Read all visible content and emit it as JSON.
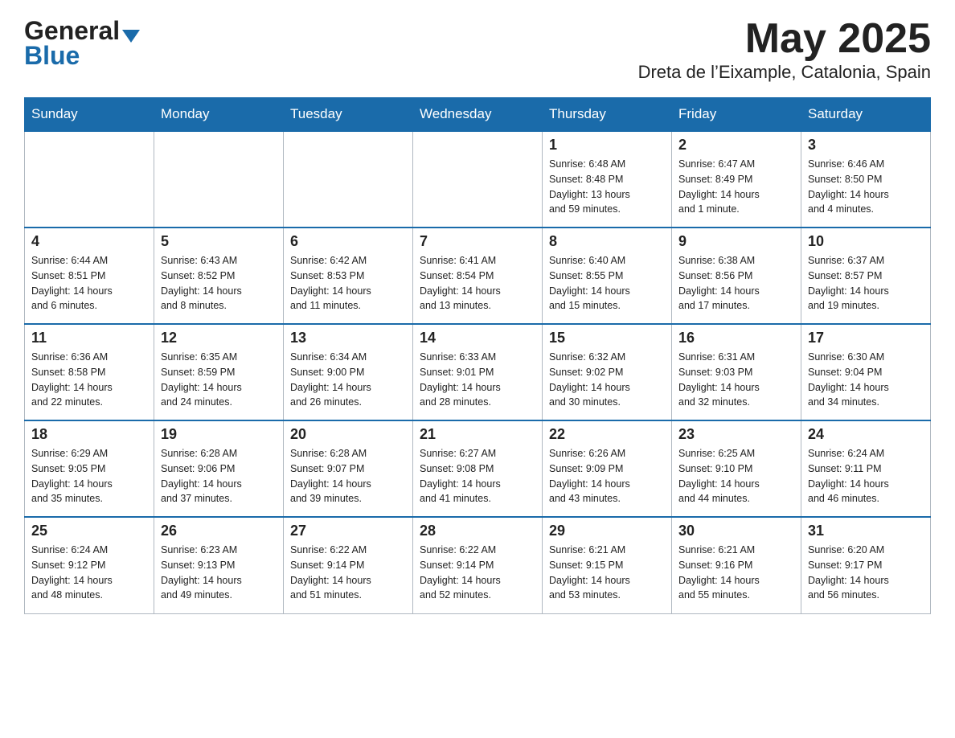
{
  "header": {
    "logo_general": "General",
    "logo_blue": "Blue",
    "title": "May 2025",
    "subtitle": "Dreta de l’Eixample, Catalonia, Spain"
  },
  "days_of_week": [
    "Sunday",
    "Monday",
    "Tuesday",
    "Wednesday",
    "Thursday",
    "Friday",
    "Saturday"
  ],
  "weeks": [
    [
      {
        "day": "",
        "info": ""
      },
      {
        "day": "",
        "info": ""
      },
      {
        "day": "",
        "info": ""
      },
      {
        "day": "",
        "info": ""
      },
      {
        "day": "1",
        "info": "Sunrise: 6:48 AM\nSunset: 8:48 PM\nDaylight: 13 hours\nand 59 minutes."
      },
      {
        "day": "2",
        "info": "Sunrise: 6:47 AM\nSunset: 8:49 PM\nDaylight: 14 hours\nand 1 minute."
      },
      {
        "day": "3",
        "info": "Sunrise: 6:46 AM\nSunset: 8:50 PM\nDaylight: 14 hours\nand 4 minutes."
      }
    ],
    [
      {
        "day": "4",
        "info": "Sunrise: 6:44 AM\nSunset: 8:51 PM\nDaylight: 14 hours\nand 6 minutes."
      },
      {
        "day": "5",
        "info": "Sunrise: 6:43 AM\nSunset: 8:52 PM\nDaylight: 14 hours\nand 8 minutes."
      },
      {
        "day": "6",
        "info": "Sunrise: 6:42 AM\nSunset: 8:53 PM\nDaylight: 14 hours\nand 11 minutes."
      },
      {
        "day": "7",
        "info": "Sunrise: 6:41 AM\nSunset: 8:54 PM\nDaylight: 14 hours\nand 13 minutes."
      },
      {
        "day": "8",
        "info": "Sunrise: 6:40 AM\nSunset: 8:55 PM\nDaylight: 14 hours\nand 15 minutes."
      },
      {
        "day": "9",
        "info": "Sunrise: 6:38 AM\nSunset: 8:56 PM\nDaylight: 14 hours\nand 17 minutes."
      },
      {
        "day": "10",
        "info": "Sunrise: 6:37 AM\nSunset: 8:57 PM\nDaylight: 14 hours\nand 19 minutes."
      }
    ],
    [
      {
        "day": "11",
        "info": "Sunrise: 6:36 AM\nSunset: 8:58 PM\nDaylight: 14 hours\nand 22 minutes."
      },
      {
        "day": "12",
        "info": "Sunrise: 6:35 AM\nSunset: 8:59 PM\nDaylight: 14 hours\nand 24 minutes."
      },
      {
        "day": "13",
        "info": "Sunrise: 6:34 AM\nSunset: 9:00 PM\nDaylight: 14 hours\nand 26 minutes."
      },
      {
        "day": "14",
        "info": "Sunrise: 6:33 AM\nSunset: 9:01 PM\nDaylight: 14 hours\nand 28 minutes."
      },
      {
        "day": "15",
        "info": "Sunrise: 6:32 AM\nSunset: 9:02 PM\nDaylight: 14 hours\nand 30 minutes."
      },
      {
        "day": "16",
        "info": "Sunrise: 6:31 AM\nSunset: 9:03 PM\nDaylight: 14 hours\nand 32 minutes."
      },
      {
        "day": "17",
        "info": "Sunrise: 6:30 AM\nSunset: 9:04 PM\nDaylight: 14 hours\nand 34 minutes."
      }
    ],
    [
      {
        "day": "18",
        "info": "Sunrise: 6:29 AM\nSunset: 9:05 PM\nDaylight: 14 hours\nand 35 minutes."
      },
      {
        "day": "19",
        "info": "Sunrise: 6:28 AM\nSunset: 9:06 PM\nDaylight: 14 hours\nand 37 minutes."
      },
      {
        "day": "20",
        "info": "Sunrise: 6:28 AM\nSunset: 9:07 PM\nDaylight: 14 hours\nand 39 minutes."
      },
      {
        "day": "21",
        "info": "Sunrise: 6:27 AM\nSunset: 9:08 PM\nDaylight: 14 hours\nand 41 minutes."
      },
      {
        "day": "22",
        "info": "Sunrise: 6:26 AM\nSunset: 9:09 PM\nDaylight: 14 hours\nand 43 minutes."
      },
      {
        "day": "23",
        "info": "Sunrise: 6:25 AM\nSunset: 9:10 PM\nDaylight: 14 hours\nand 44 minutes."
      },
      {
        "day": "24",
        "info": "Sunrise: 6:24 AM\nSunset: 9:11 PM\nDaylight: 14 hours\nand 46 minutes."
      }
    ],
    [
      {
        "day": "25",
        "info": "Sunrise: 6:24 AM\nSunset: 9:12 PM\nDaylight: 14 hours\nand 48 minutes."
      },
      {
        "day": "26",
        "info": "Sunrise: 6:23 AM\nSunset: 9:13 PM\nDaylight: 14 hours\nand 49 minutes."
      },
      {
        "day": "27",
        "info": "Sunrise: 6:22 AM\nSunset: 9:14 PM\nDaylight: 14 hours\nand 51 minutes."
      },
      {
        "day": "28",
        "info": "Sunrise: 6:22 AM\nSunset: 9:14 PM\nDaylight: 14 hours\nand 52 minutes."
      },
      {
        "day": "29",
        "info": "Sunrise: 6:21 AM\nSunset: 9:15 PM\nDaylight: 14 hours\nand 53 minutes."
      },
      {
        "day": "30",
        "info": "Sunrise: 6:21 AM\nSunset: 9:16 PM\nDaylight: 14 hours\nand 55 minutes."
      },
      {
        "day": "31",
        "info": "Sunrise: 6:20 AM\nSunset: 9:17 PM\nDaylight: 14 hours\nand 56 minutes."
      }
    ]
  ]
}
